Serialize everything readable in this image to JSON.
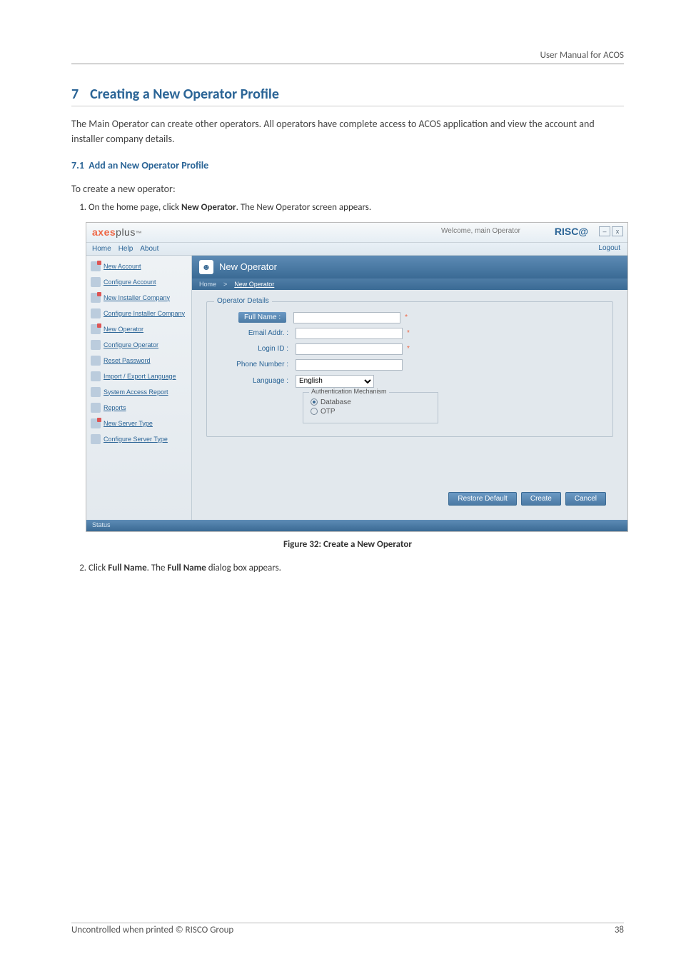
{
  "doc_header": "User Manual for ACOS",
  "section_num": "7",
  "section_title": "Creating a New Operator Profile",
  "intro_para": "The Main Operator can create other operators. All operators have complete access to ACOS application and view the account and installer company details.",
  "subsec_num": "7.1",
  "subsec_title": "Add an New Operator Profile",
  "lead_in": "To create a new operator:",
  "step1_prefix": "On the home page, click ",
  "step1_bold": "New Operator",
  "step1_suffix": ". The New Operator screen appears.",
  "figure_caption": "Figure 32: Create a New Operator",
  "step2_prefix": "Click ",
  "step2_bold1": "Full Name",
  "step2_mid": ". The ",
  "step2_bold2": "Full Name",
  "step2_suffix": " dialog box appears.",
  "footer_left": "Uncontrolled when printed © RISCO Group",
  "footer_right": "38",
  "ss": {
    "brand_ax": "axes",
    "brand_plus": "plus",
    "brand_tm": "™",
    "welcome": "Welcome, main Operator",
    "risco": "RISC@",
    "winmin": "–",
    "winclose": "x",
    "menu": {
      "home": "Home",
      "help": "Help",
      "about": "About"
    },
    "logout": "Logout",
    "sidebar": [
      "New Account",
      "Configure Account",
      "New Installer Company",
      "Configure Installer Company",
      "New Operator",
      "Configure Operator",
      "Reset Password",
      "Import / Export Language",
      "System Access Report",
      "Reports",
      "New Server Type",
      "Configure Server Type"
    ],
    "main_title": "New Operator",
    "crumb_home": "Home",
    "crumb_sep": ">",
    "crumb_cur": "New Operator",
    "legend": "Operator Details",
    "labels": {
      "fullname": "Full Name :",
      "email": "Email Addr. :",
      "login": "Login ID :",
      "phone": "Phone Number :",
      "lang": "Language :"
    },
    "lang_value": "English",
    "auth_legend": "Authentication Mechanism",
    "auth_db": "Database",
    "auth_otp": "OTP",
    "req": "*",
    "btn_restore": "Restore Default",
    "btn_create": "Create",
    "btn_cancel": "Cancel",
    "status": "Status"
  }
}
